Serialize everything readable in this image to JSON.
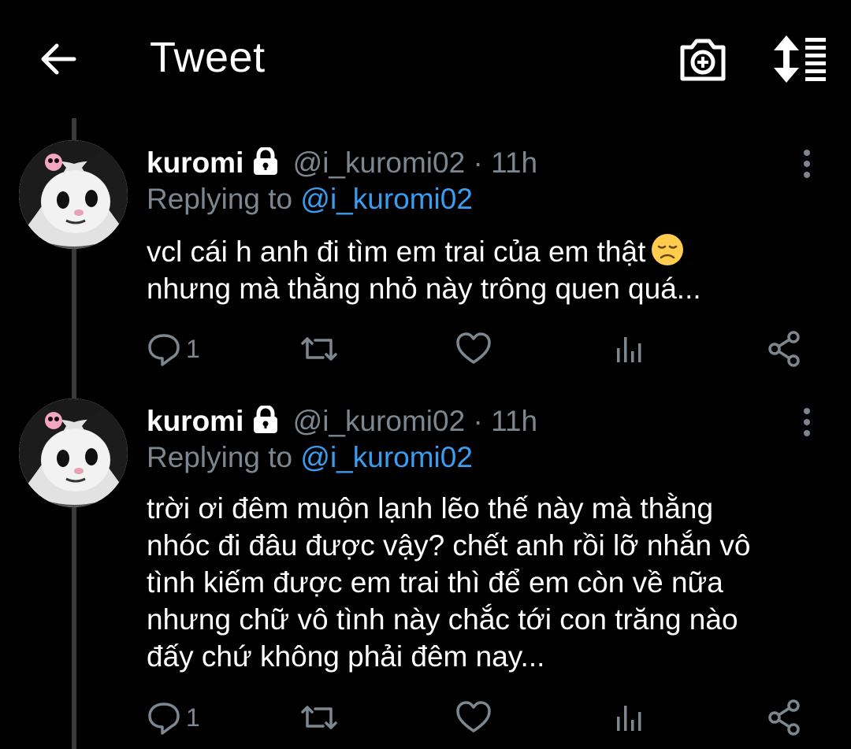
{
  "header": {
    "title": "Tweet",
    "back_icon": "arrow-left-icon",
    "camera_icon": "camera-add-icon",
    "sort_icon": "sort-icon"
  },
  "colors": {
    "background": "#000000",
    "text": "#ffffff",
    "muted": "#7d8790",
    "link": "#3b9df0",
    "thread_line": "#3a3a3a"
  },
  "tweets": [
    {
      "name": "kuromi",
      "handle": "@i_kuromi02",
      "separator": "·",
      "time": "11h",
      "replying_label": "Replying to",
      "replying_to": "@i_kuromi02",
      "line1": "vcl cái h anh đi tìm em trai của em thật",
      "emoji": "disappointed-face-emoji",
      "line2": "nhưng mà thằng nhỏ này trông quen quá...",
      "reply_count": "1"
    },
    {
      "name": "kuromi",
      "handle": "@i_kuromi02",
      "separator": "·",
      "time": "11h",
      "replying_label": "Replying to",
      "replying_to": "@i_kuromi02",
      "lines": [
        "trời ơi đêm muộn lạnh lẽo thế này mà thằng",
        "nhóc đi đâu được vậy? chết anh rồi lỡ nhắn vô",
        "tình kiếm được em trai thì để em còn về nữa",
        "nhưng chữ vô tình này chắc tới con trăng nào",
        "đấy chứ không phải đêm nay..."
      ],
      "reply_count": "1"
    }
  ]
}
